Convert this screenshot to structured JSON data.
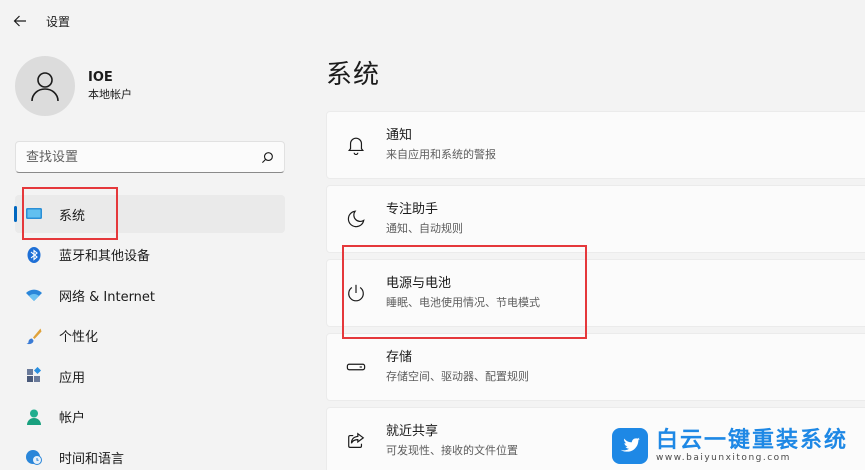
{
  "app": {
    "title": "设置"
  },
  "profile": {
    "name": "IOE",
    "account_type": "本地帐户"
  },
  "search": {
    "placeholder": "查找设置"
  },
  "sidebar": {
    "items": [
      {
        "label": "系统",
        "icon": "system-display-icon",
        "active": true
      },
      {
        "label": "蓝牙和其他设备",
        "icon": "bluetooth-icon",
        "active": false
      },
      {
        "label": "网络 & Internet",
        "icon": "wifi-icon",
        "active": false
      },
      {
        "label": "个性化",
        "icon": "brush-icon",
        "active": false
      },
      {
        "label": "应用",
        "icon": "apps-icon",
        "active": false
      },
      {
        "label": "帐户",
        "icon": "account-icon",
        "active": false
      },
      {
        "label": "时间和语言",
        "icon": "globe-clock-icon",
        "active": false
      }
    ]
  },
  "main": {
    "title": "系统",
    "cards": [
      {
        "title": "通知",
        "desc": "来自应用和系统的警报",
        "icon": "bell-icon"
      },
      {
        "title": "专注助手",
        "desc": "通知、自动规则",
        "icon": "moon-icon"
      },
      {
        "title": "电源与电池",
        "desc": "睡眠、电池使用情况、节电模式",
        "icon": "power-icon"
      },
      {
        "title": "存储",
        "desc": "存储空间、驱动器、配置规则",
        "icon": "storage-icon"
      },
      {
        "title": "就近共享",
        "desc": "可发现性、接收的文件位置",
        "icon": "share-icon"
      }
    ]
  },
  "watermark": {
    "name": "白云一键重装系统",
    "url": "www.baiyunxitong.com"
  },
  "colors": {
    "accent": "#0067c0",
    "annotation_red": "#e5383b",
    "watermark_blue": "#1e88e5"
  }
}
